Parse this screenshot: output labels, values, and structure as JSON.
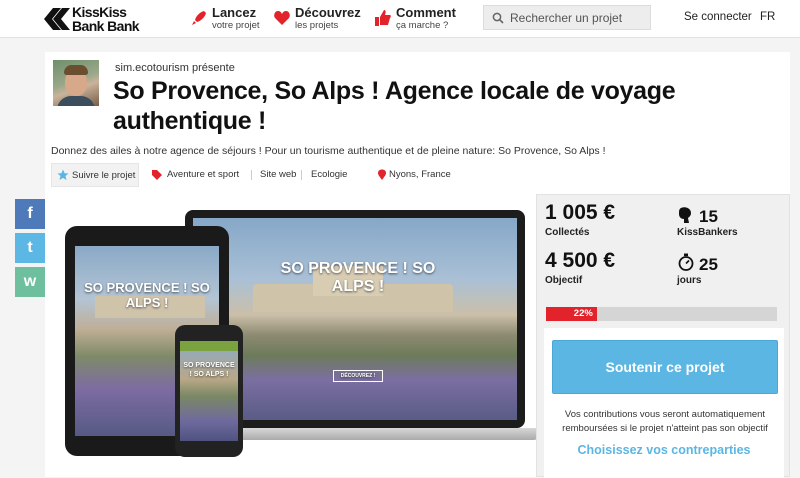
{
  "brand": {
    "logo_line1": "KissKiss",
    "logo_line2": "Bank Bank"
  },
  "nav": {
    "items": [
      {
        "title": "Lancez",
        "subtitle": "votre projet",
        "icon": "rocket-icon"
      },
      {
        "title": "Découvrez",
        "subtitle": "les projets",
        "icon": "heart-icon"
      },
      {
        "title": "Comment",
        "subtitle": "ça marche ?",
        "icon": "thumbs-up-icon"
      }
    ],
    "search_placeholder": "Rechercher un projet",
    "login": "Se connecter",
    "lang": "FR"
  },
  "project": {
    "presenter": "sim.ecotourism présente",
    "title": "So Provence, So Alps ! Agence locale de voyage authentique !",
    "description": "Donnez des ailes à notre agence de séjours ! Pour un tourisme authentique et de pleine nature: So Provence, So Alps !",
    "tags": {
      "follow": "Suivre le projet",
      "category": "Aventure et sport",
      "website": "Site web",
      "theme": "Ecologie",
      "location": "Nyons, France"
    },
    "media": {
      "laptop_title": "SO PROVENCE ! SO ALPS !",
      "tablet_title": "SO PROVENCE ! SO ALPS !",
      "phone_title": "SO PROVENCE ! SO ALPS !",
      "cta_label": "DÉCOUVREZ !"
    }
  },
  "stats": {
    "collected": "1 005 €",
    "collected_label": "Collectés",
    "backers": "15",
    "backers_label": "KissBankers",
    "goal": "4 500 €",
    "goal_label": "Objectif",
    "days": "25",
    "days_label": "jours",
    "progress_percent": 22,
    "progress_label": "22%",
    "progress_color": "#e3232c"
  },
  "support": {
    "button_label": "Soutenir ce projet",
    "note": "Vos contributions vous seront automatiquement remboursées si le projet n'atteint pas son objectif",
    "rewards_link": "Choisissez vos contreparties",
    "accent_color": "#5cb6e3"
  },
  "social": {
    "facebook": "f",
    "twitter": "t",
    "website": "w"
  }
}
